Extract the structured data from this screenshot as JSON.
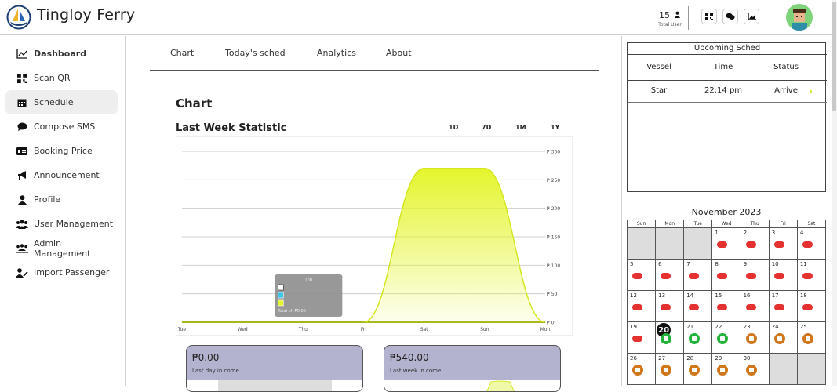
{
  "app": {
    "title": "Tingloy Ferry"
  },
  "header": {
    "user_count": "15",
    "user_label": "Total User"
  },
  "sidebar": {
    "items": [
      {
        "label": "Dashboard",
        "icon": "chart-line-icon"
      },
      {
        "label": "Scan QR",
        "icon": "qr-icon"
      },
      {
        "label": "Schedule",
        "icon": "calendar-icon"
      },
      {
        "label": "Compose SMS",
        "icon": "chat-icon"
      },
      {
        "label": "Booking Price",
        "icon": "money-icon"
      },
      {
        "label": "Announcement",
        "icon": "megaphone-icon"
      },
      {
        "label": "Profile",
        "icon": "user-icon"
      },
      {
        "label": "User Management",
        "icon": "users-icon"
      },
      {
        "label": "Admin Management",
        "icon": "admins-icon"
      },
      {
        "label": "Import Passenger",
        "icon": "user-import-icon"
      }
    ]
  },
  "tabs": [
    "Chart",
    "Today's sched",
    "Analytics",
    "About"
  ],
  "main": {
    "heading": "Chart",
    "subheading": "Last Week Statistic",
    "ranges": [
      "1D",
      "7D",
      "1M",
      "1Y"
    ]
  },
  "chart_data": {
    "type": "area",
    "title": "Last Week Statistic",
    "categories": [
      "Tue",
      "Wed",
      "Thu",
      "Fri",
      "Sat",
      "Sun",
      "Mon"
    ],
    "series": [
      {
        "values": [
          0,
          0,
          0,
          0,
          270,
          270,
          0
        ]
      }
    ],
    "y_ticks": [
      "₱ 0",
      "₱ 50",
      "₱ 100",
      "₱ 150",
      "₱ 200",
      "₱ 250",
      "₱ 300"
    ],
    "ylim": [
      0,
      300
    ],
    "grid": true,
    "color": "#e4f52c",
    "tooltip": {
      "title": "Thu",
      "total": "Total of: ₱0.00"
    }
  },
  "cards": [
    {
      "amount": "₱0.00",
      "caption": "Last day in come"
    },
    {
      "amount": "₱540.00",
      "caption": "Last week in come"
    }
  ],
  "upcoming": {
    "title": "Upcoming Sched",
    "headers": [
      "Vessel",
      "Time",
      "Status"
    ],
    "rows": [
      {
        "vessel": "Star",
        "time": "22:14 pm",
        "status": "Arrive"
      }
    ]
  },
  "calendar": {
    "title": "November 2023",
    "days": [
      "Sun",
      "Mon",
      "Tue",
      "Wed",
      "Thu",
      "Fri",
      "Sat"
    ],
    "today": "20",
    "weeks": [
      [
        null,
        null,
        null,
        {
          "d": "1",
          "s": "red"
        },
        {
          "d": "2",
          "s": "red"
        },
        {
          "d": "3",
          "s": "red"
        },
        {
          "d": "4",
          "s": "red"
        }
      ],
      [
        {
          "d": "5",
          "s": "red"
        },
        {
          "d": "6",
          "s": "red"
        },
        {
          "d": "7",
          "s": "red"
        },
        {
          "d": "8",
          "s": "red"
        },
        {
          "d": "9",
          "s": "red"
        },
        {
          "d": "10",
          "s": "red"
        },
        {
          "d": "11",
          "s": "red"
        }
      ],
      [
        {
          "d": "12",
          "s": "red"
        },
        {
          "d": "13",
          "s": "red"
        },
        {
          "d": "14",
          "s": "red"
        },
        {
          "d": "15",
          "s": "red"
        },
        {
          "d": "16",
          "s": "red"
        },
        {
          "d": "17",
          "s": "red"
        },
        {
          "d": "18",
          "s": "red"
        }
      ],
      [
        {
          "d": "19",
          "s": "red"
        },
        {
          "d": "20",
          "s": "green"
        },
        {
          "d": "21",
          "s": "green"
        },
        {
          "d": "22",
          "s": "green"
        },
        {
          "d": "23",
          "s": "orange"
        },
        {
          "d": "24",
          "s": "orange"
        },
        {
          "d": "25",
          "s": "orange"
        }
      ],
      [
        {
          "d": "26",
          "s": "orange"
        },
        {
          "d": "27",
          "s": "orange"
        },
        {
          "d": "28",
          "s": "orange"
        },
        {
          "d": "29",
          "s": "orange"
        },
        {
          "d": "30",
          "s": "orange"
        },
        null,
        null
      ]
    ]
  }
}
